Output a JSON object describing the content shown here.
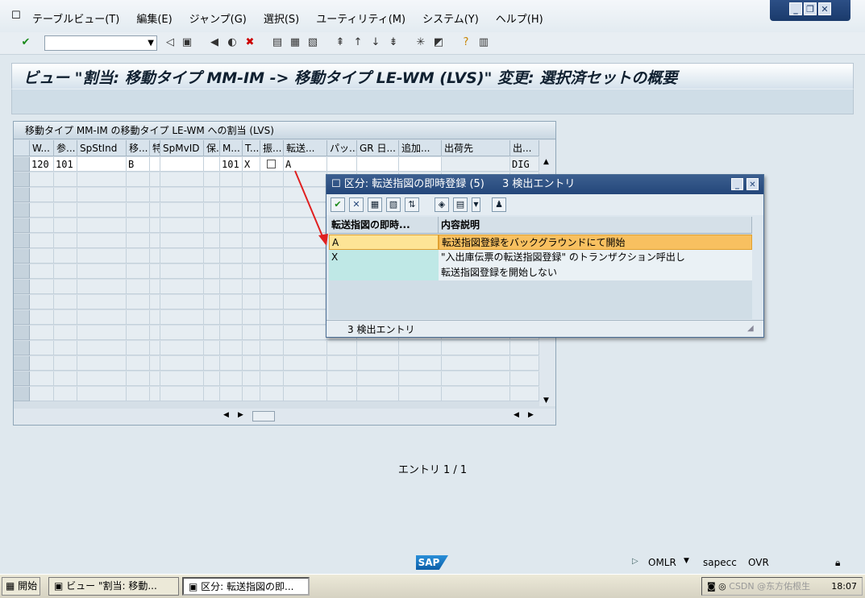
{
  "window": {
    "controls": [
      "_",
      "❐",
      "✕"
    ]
  },
  "menu": [
    "テーブルビュー(T)",
    "編集(E)",
    "ジャンプ(G)",
    "選択(S)",
    "ユーティリティ(M)",
    "システム(Y)",
    "ヘルプ(H)"
  ],
  "toolbar": {
    "command_value": ""
  },
  "title": "ビュー \"割当: 移動タイプ MM-IM -> 移動タイプ LE-WM (LVS)\" 変更: 選択済セットの概要",
  "table": {
    "title": "移動タイプ MM-IM の移動タイプ LE-WM への割当 (LVS)",
    "columns": [
      "W...",
      "参...",
      "SpStInd",
      "移...",
      "特",
      "SpMvID",
      "保...",
      "M...",
      "T...",
      "振...",
      "転送...",
      "パッ...",
      "GR 日...",
      "追加...",
      "出荷先",
      "出..."
    ],
    "row": [
      "120",
      "101",
      "",
      "B",
      "",
      "",
      "",
      "101",
      "X",
      "",
      "A",
      "",
      "",
      "",
      "",
      "DIG"
    ]
  },
  "entries_text": "エントリ 1 / 1",
  "popup": {
    "title": "区分: 転送指図の即時登録 (5)",
    "hits": "3 検出エントリ",
    "col_key": "転送指図の即時...",
    "col_desc": "内容説明",
    "rows": [
      {
        "key": "A",
        "desc": "転送指図登録をバックグラウンドにて開始"
      },
      {
        "key": "X",
        "desc": "\"入出庫伝票の転送指図登録\" のトランザクション呼出し"
      },
      {
        "key": "",
        "desc": "転送指図登録を開始しない"
      }
    ],
    "status": "3 検出エントリ"
  },
  "statusbar": {
    "logo": "SAP",
    "tcode": "OMLR",
    "server": "sapecc",
    "mode": "OVR"
  },
  "taskbar": {
    "start": "開始",
    "tasks": [
      "ビュー \"割当: 移動...",
      "区分: 転送指図の即..."
    ],
    "watermark": "CSDN @东方佑根生",
    "clock": "18:07"
  }
}
